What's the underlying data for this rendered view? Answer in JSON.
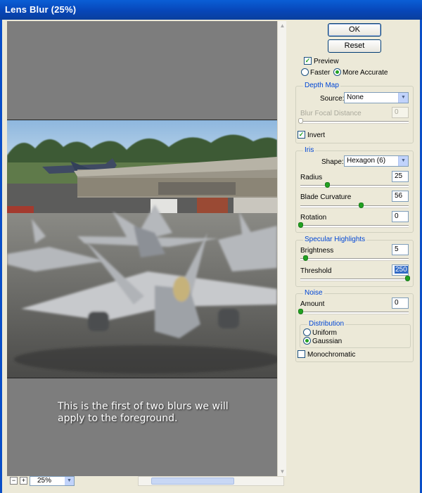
{
  "window": {
    "title": "Lens Blur (25%)"
  },
  "buttons": {
    "ok": "OK",
    "reset": "Reset"
  },
  "preview_opts": {
    "preview": "Preview",
    "preview_checked": true,
    "faster": "Faster",
    "more_accurate": "More Accurate",
    "selected": "More Accurate"
  },
  "depth_map": {
    "title": "Depth Map",
    "source_label": "Source:",
    "source_value": "None",
    "focal_label": "Blur Focal Distance",
    "focal_value": "0",
    "invert_label": "Invert",
    "invert_checked": true
  },
  "iris": {
    "title": "Iris",
    "shape_label": "Shape:",
    "shape_value": "Hexagon (6)",
    "radius_label": "Radius",
    "radius_value": "25",
    "curvature_label": "Blade Curvature",
    "curvature_value": "56",
    "rotation_label": "Rotation",
    "rotation_value": "0"
  },
  "specular": {
    "title": "Specular Highlights",
    "brightness_label": "Brightness",
    "brightness_value": "5",
    "threshold_label": "Threshold",
    "threshold_value": "250"
  },
  "noise": {
    "title": "Noise",
    "amount_label": "Amount",
    "amount_value": "0",
    "distribution_title": "Distribution",
    "uniform": "Uniform",
    "gaussian": "Gaussian",
    "selected": "Gaussian",
    "mono_label": "Monochromatic",
    "mono_checked": false
  },
  "preview_area": {
    "caption_line1": "This is the first of two blurs we will",
    "caption_line2": "apply to the foreground."
  },
  "zoom": {
    "minus": "−",
    "plus": "+",
    "value": "25%"
  },
  "colors": {
    "title_bar": "#0a4fc7",
    "group_title": "#0046d5",
    "slider_knob": "#21a121"
  }
}
